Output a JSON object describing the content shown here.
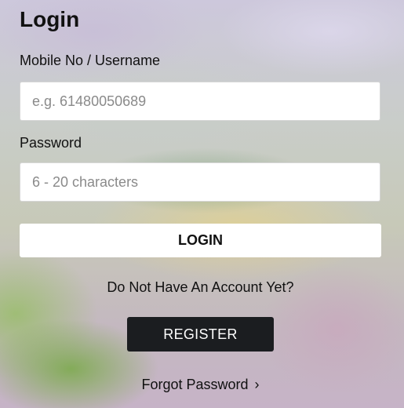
{
  "page": {
    "title": "Login"
  },
  "form": {
    "username": {
      "label": "Mobile No / Username",
      "placeholder": "e.g. 61480050689",
      "value": ""
    },
    "password": {
      "label": "Password",
      "placeholder": "6 - 20 characters",
      "value": ""
    },
    "login_button": "LOGIN"
  },
  "signup": {
    "prompt": "Do Not Have An Account Yet?",
    "register_button": "REGISTER"
  },
  "forgot": {
    "label": "Forgot Password",
    "icon": "chevron-right-icon",
    "glyph": "›"
  }
}
